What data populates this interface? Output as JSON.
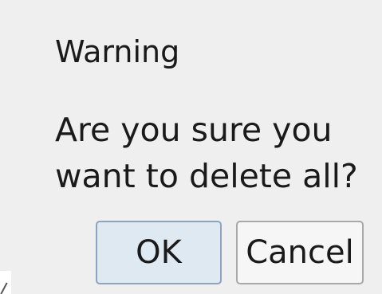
{
  "dialog": {
    "title": "Warning",
    "message": "Are you sure you want to delete all?",
    "buttons": {
      "ok": "OK",
      "cancel": "Cancel"
    }
  },
  "colors": {
    "dialog_background": "#efefef",
    "ok_button_background": "#dfe9f2",
    "ok_button_border": "#8ea3bd",
    "cancel_button_background": "#f6f6f6",
    "cancel_button_border": "#a8a8a8",
    "text": "#1a1a1a"
  }
}
